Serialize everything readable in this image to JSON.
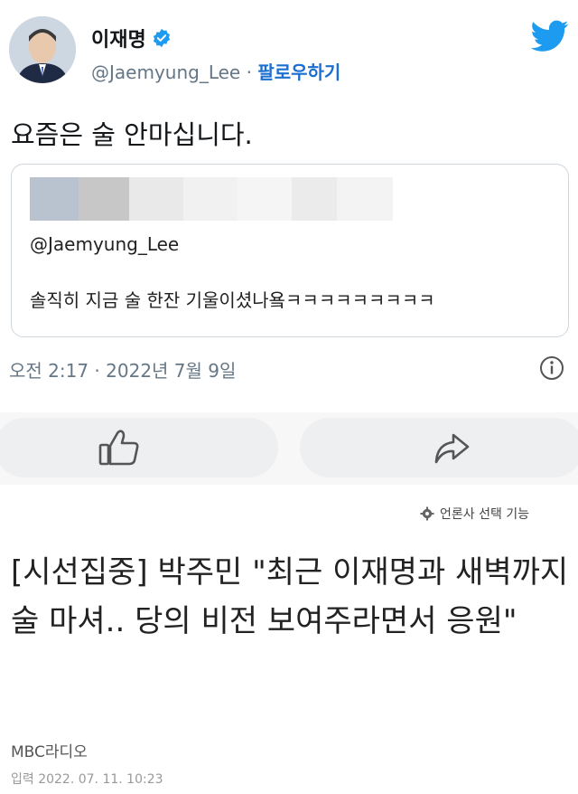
{
  "tweet": {
    "author_name": "이재명",
    "handle": "@Jaemyung_Lee",
    "separator": "·",
    "follow_label": "팔로우하기",
    "text": "요즘은 술 안마십니다.",
    "quoted": {
      "handle": "@Jaemyung_Lee",
      "text": "솔직히 지금 술 한잔 기울이셨나욬ㅋㅋㅋㅋㅋㅋㅋㅋㅋ"
    },
    "timestamp": "오전 2:17 · 2022년 7월 9일"
  },
  "icons": {
    "verified": "verified-badge-icon",
    "twitter": "twitter-bird-icon",
    "info": "info-icon",
    "like": "thumbs-up-icon",
    "share": "share-arrow-icon",
    "settings": "gear-icon"
  },
  "colors": {
    "twitter_blue": "#1d9bf0",
    "follow_link": "#1b6fd1",
    "muted": "#657786"
  },
  "news": {
    "publisher_choice_label": "언론사 선택 기능",
    "headline": "[시선집중] 박주민 \"최근 이재명과 새벽까지 술 마셔.. 당의 비전 보여주라면서 응원\"",
    "source": "MBC라디오",
    "published": "입력 2022. 07. 11. 10:23"
  }
}
